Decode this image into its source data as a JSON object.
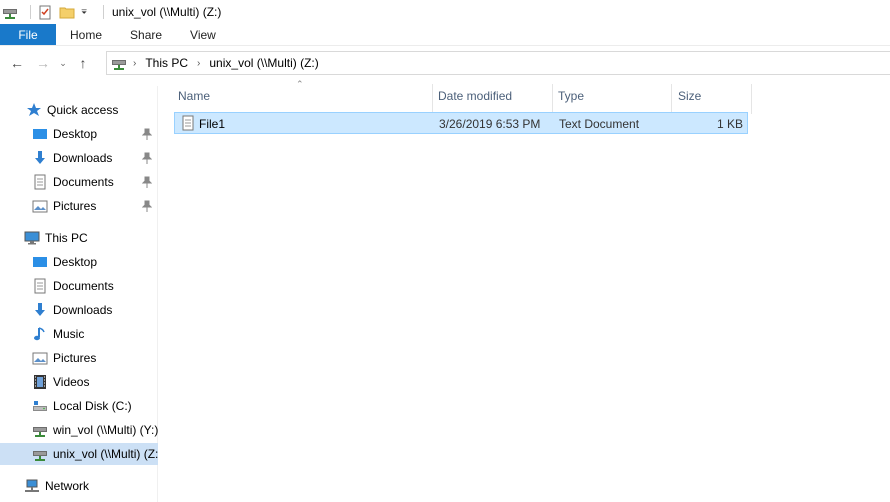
{
  "window": {
    "title": "unix_vol (\\\\Multi) (Z:)"
  },
  "ribbon": {
    "file_tab": "File",
    "tabs": [
      "Home",
      "Share",
      "View"
    ]
  },
  "address": {
    "crumbs": [
      "This PC",
      "unix_vol (\\\\Multi) (Z:)"
    ]
  },
  "nav": {
    "quick_access": "Quick access",
    "quick_items": [
      "Desktop",
      "Downloads",
      "Documents",
      "Pictures"
    ],
    "this_pc": "This PC",
    "pc_items": [
      "Desktop",
      "Documents",
      "Downloads",
      "Music",
      "Pictures",
      "Videos",
      "Local Disk (C:)",
      "win_vol (\\\\Multi) (Y:)",
      "unix_vol (\\\\Multi) (Z:)"
    ],
    "network": "Network"
  },
  "columns": {
    "name": "Name",
    "date": "Date modified",
    "type": "Type",
    "size": "Size"
  },
  "files": [
    {
      "name": "File1",
      "date": "3/26/2019 6:53 PM",
      "type": "Text Document",
      "size": "1 KB"
    }
  ],
  "colors": {
    "accent": "#1979ca",
    "selection": "#cce8ff",
    "nav_selection": "#cce0f5"
  }
}
